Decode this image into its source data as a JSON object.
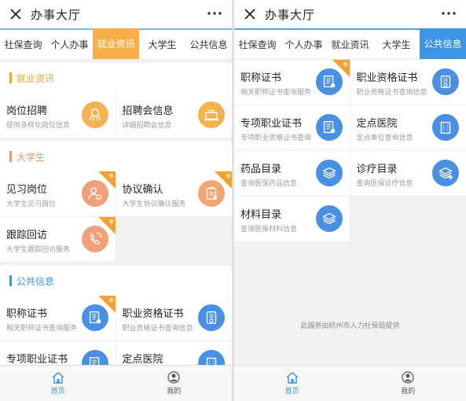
{
  "app": {
    "title": "办事大厅"
  },
  "tabs": [
    "社保查询",
    "个人办事",
    "就业资讯",
    "大学生",
    "公共信息"
  ],
  "colors": {
    "orange": "#f8b04c",
    "blue": "#3d95e4",
    "accent_blue": "#4a90e2",
    "corner": "#f0a332"
  },
  "left_panel": {
    "active_tab": "就业资讯",
    "sections": [
      {
        "title": "就业资讯",
        "bar_color": "#f0a332",
        "title_color": "#f0a332",
        "items": [
          {
            "name": "岗位招聘",
            "desc": "提供多样化岗位信息",
            "icon": "octopus-icon",
            "color": "#f6b24e",
            "new": false
          },
          {
            "name": "招聘会信息",
            "desc": "详细招聘会信息",
            "icon": "briefcase-desk-icon",
            "color": "#f6b24e",
            "new": false
          }
        ]
      },
      {
        "title": "大学生",
        "bar_color": "#f09565",
        "title_color": "#f09565",
        "items": [
          {
            "name": "见习岗位",
            "desc": "大学生见习岗位",
            "icon": "person-gear-icon",
            "color": "#f2a07a",
            "new": true
          },
          {
            "name": "协议确认",
            "desc": "大学生协议确认服务",
            "icon": "clipboard-icon",
            "color": "#f4a577",
            "new": true
          },
          {
            "name": "跟踪回访",
            "desc": "大学生跟踪回访服务",
            "icon": "phone-refresh-icon",
            "color": "#f2a07a",
            "new": true
          }
        ]
      },
      {
        "title": "公共信息",
        "bar_color": "#3d95e4",
        "title_color": "#3d95e4",
        "items": [
          {
            "name": "职称证书",
            "desc": "相关职称证书查询服务",
            "icon": "certificate-icon",
            "color": "#4a90e2",
            "new": true
          },
          {
            "name": "职业资格证书",
            "desc": "职业资格证书查询信息",
            "icon": "id-card-icon",
            "color": "#4a90e2",
            "new": false
          },
          {
            "name": "专项职业证书",
            "desc": "",
            "icon": "certificate-icon",
            "color": "#4a90e2",
            "new": false
          },
          {
            "name": "定点医院",
            "desc": "",
            "icon": "hospital-icon",
            "color": "#4a90e2",
            "new": false
          }
        ]
      }
    ]
  },
  "right_panel": {
    "active_tab": "公共信息",
    "items": [
      {
        "name": "职称证书",
        "desc": "相关职称证书查询服务",
        "icon": "certificate-icon",
        "color": "#4a90e2",
        "new": true
      },
      {
        "name": "职业资格证书",
        "desc": "职业资格证书查询信息",
        "icon": "id-card-icon",
        "color": "#4a90e2",
        "new": false
      },
      {
        "name": "专项职业证书",
        "desc": "专项职业资格证书查询",
        "icon": "certificate-icon",
        "color": "#4a90e2",
        "new": false
      },
      {
        "name": "定点医院",
        "desc": "定点单位查询信息",
        "icon": "hospital-icon",
        "color": "#4a90e2",
        "new": false
      },
      {
        "name": "药品目录",
        "desc": "查询医保药品信息",
        "icon": "stack-icon",
        "color": "#4a90e2",
        "new": false
      },
      {
        "name": "诊疗目录",
        "desc": "查询医保诊疗信息",
        "icon": "stack-plus-icon",
        "color": "#4a90e2",
        "new": false
      },
      {
        "name": "材料目录",
        "desc": "查询医保材料信息",
        "icon": "stack-icon",
        "color": "#4a90e2",
        "new": false
      }
    ],
    "footer_note": "此服务由杭州市人力社保局提供"
  },
  "bottom_bar": [
    {
      "label": "首页",
      "icon": "home-icon",
      "active": true
    },
    {
      "label": "我的",
      "icon": "user-icon",
      "active": false
    }
  ],
  "badge_text": "新"
}
